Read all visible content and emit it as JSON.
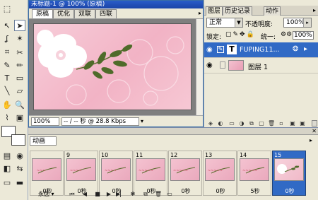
{
  "document": {
    "title": "未标题-1 @ 100% (原稿)",
    "tabs": [
      "原稿",
      "优化",
      "双联",
      "四联"
    ],
    "zoom": "100%",
    "status": "-- / -- 秒 @ 28.8 Kbps"
  },
  "layers_panel": {
    "tabs": [
      "图层",
      "历史记录",
      "动作"
    ],
    "blend_mode": "正常",
    "opacity_label": "不透明度:",
    "opacity_value": "100%",
    "lock_label": "锁定:",
    "unify_label": "统一:",
    "fill_value": "100%",
    "layers": [
      {
        "name": "FUPING11...",
        "type": "text",
        "selected": true
      },
      {
        "name": "图层 1",
        "type": "image",
        "selected": false
      }
    ]
  },
  "animation_panel": {
    "title": "动画",
    "frames": [
      {
        "number": "",
        "delay": "0秒"
      },
      {
        "number": "9",
        "delay": "0秒"
      },
      {
        "number": "10",
        "delay": "0秒"
      },
      {
        "number": "11",
        "delay": "0秒"
      },
      {
        "number": "12",
        "delay": "0秒"
      },
      {
        "number": "13",
        "delay": "0秒"
      },
      {
        "number": "14",
        "delay": "5秒"
      },
      {
        "number": "15",
        "delay": "0秒"
      }
    ],
    "loop": "永远"
  },
  "colors": {
    "accent": "#316ac5",
    "titlebar": "#2a5cc8",
    "stage_pink": "#f2b3c5"
  }
}
